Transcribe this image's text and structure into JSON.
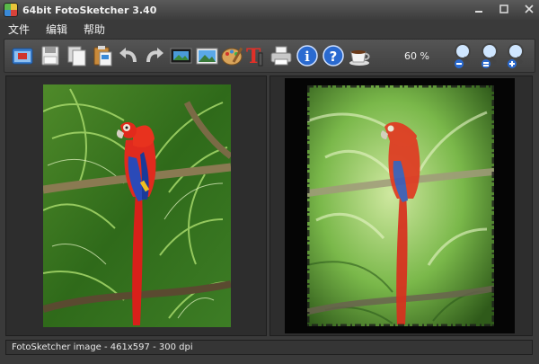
{
  "window": {
    "title": "64bit FotoSketcher 3.40"
  },
  "menu": {
    "items": [
      "文件",
      "编辑",
      "帮助"
    ]
  },
  "toolbar": {
    "zoom": "60 %"
  },
  "status": {
    "text": "FotoSketcher image - 461x597 - 300 dpi"
  }
}
